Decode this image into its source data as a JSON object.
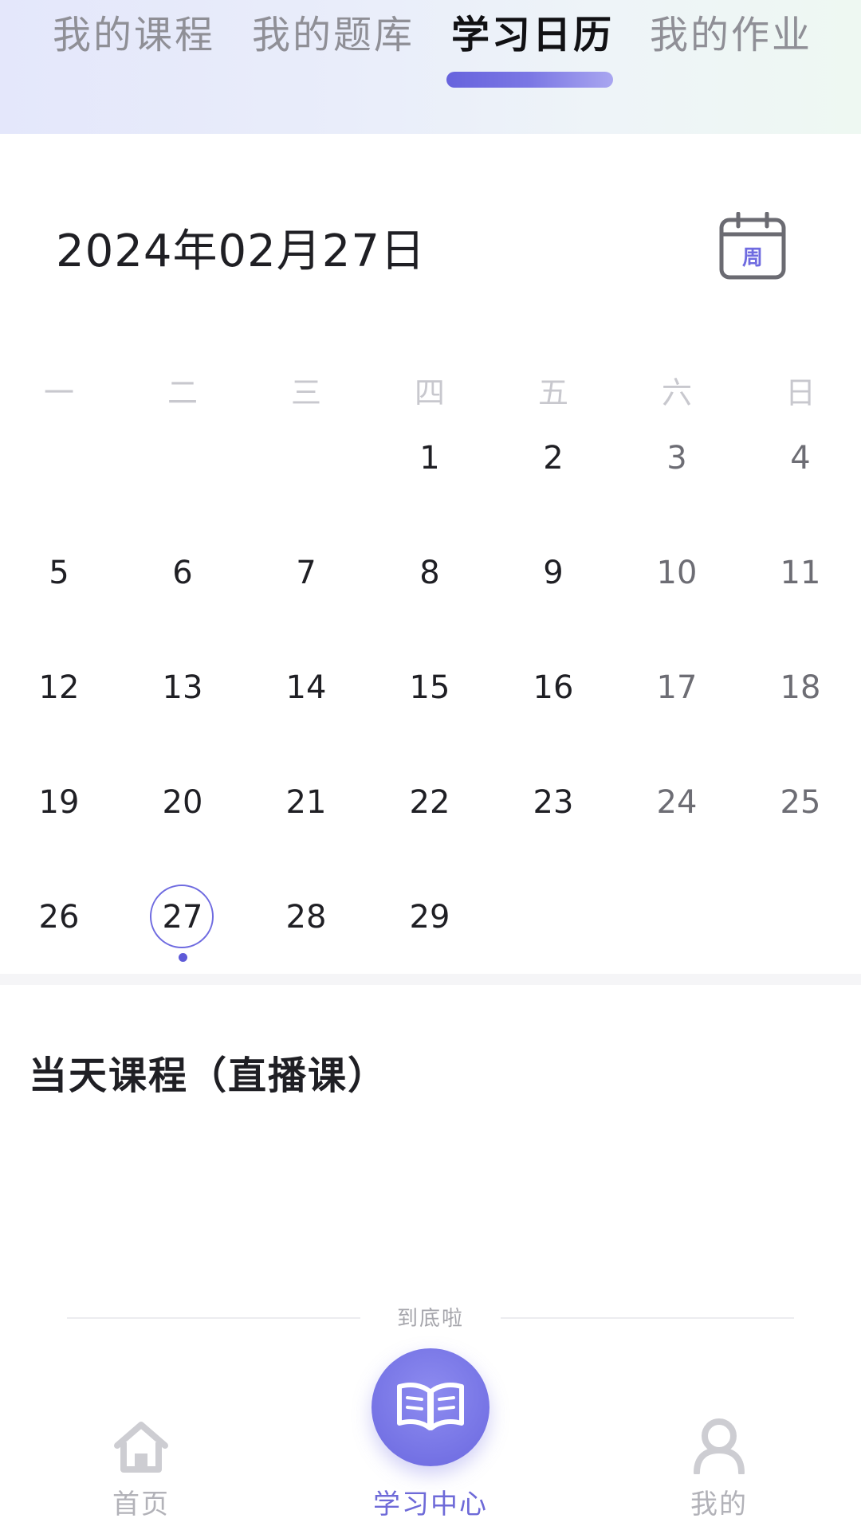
{
  "tabs": [
    {
      "label": "我的课程",
      "active": false
    },
    {
      "label": "我的题库",
      "active": false
    },
    {
      "label": "学习日历",
      "active": true
    },
    {
      "label": "我的作业",
      "active": false
    }
  ],
  "date_title": "2024年02月27日",
  "week_toggle_label": "周",
  "calendar": {
    "weekdays": [
      "一",
      "二",
      "三",
      "四",
      "五",
      "六",
      "日"
    ],
    "first_weekday_index": 3,
    "days_in_month": 29,
    "selected_day": 27,
    "days_with_events": [
      27
    ]
  },
  "section_title": "当天课程（直播课）",
  "end_text": "到底啦",
  "bottom_nav": {
    "home": "首页",
    "study_center": "学习中心",
    "mine": "我的"
  },
  "colors": {
    "accent": "#6f6be0",
    "tab_active": "#111114",
    "tab_inactive": "#8f8f96",
    "nav_inactive": "#b2b2b8"
  }
}
